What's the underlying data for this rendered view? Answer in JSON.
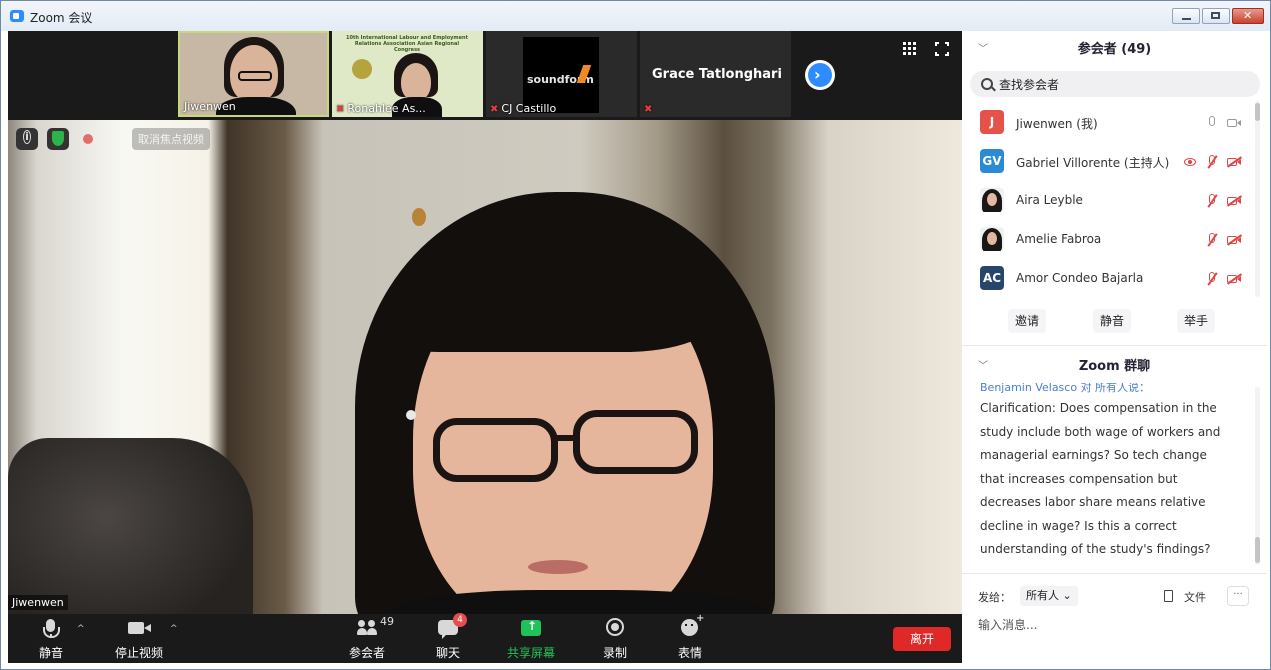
{
  "window": {
    "title": "Zoom 会议"
  },
  "thumbnails": [
    {
      "name": "Jiwenwen"
    },
    {
      "name": "Ronahlee As...",
      "poster_text": "10th International Labour and Employment Relations Association Asian Regional Congress"
    },
    {
      "name": "CJ Castillo",
      "logo_text": "soundform"
    },
    {
      "name": "Grace Tatlonghari"
    }
  ],
  "main_video": {
    "unpin_label": "取消焦点视频",
    "name_tag": "Jiwenwen"
  },
  "toolbar": {
    "mute": "静音",
    "stop_video": "停止视频",
    "participants": "参会者",
    "participants_count": "49",
    "chat": "聊天",
    "chat_badge": "4",
    "share": "共享屏幕",
    "record": "录制",
    "reactions": "表情",
    "leave": "离开"
  },
  "participants_panel": {
    "title": "参会者 (49)",
    "search_placeholder": "查找参会者",
    "items": [
      {
        "initials": "J",
        "name": "Jiwenwen (我)",
        "color": "#e5524a"
      },
      {
        "initials": "GV",
        "name": "Gabriel Villorente (主持人)",
        "color": "#2a8ad6"
      },
      {
        "initials": "",
        "name": "Aira Leyble",
        "color": "#f1f1f1"
      },
      {
        "initials": "",
        "name": "Amelie Fabroa",
        "color": "#f1f1f1"
      },
      {
        "initials": "AC",
        "name": "Amor Condeo Bajarla",
        "color": "#27466b"
      }
    ],
    "buttons": {
      "invite": "邀请",
      "mute_all": "静音",
      "raise_hand": "举手"
    }
  },
  "chat_panel": {
    "title": "Zoom 群聊",
    "sender": "Benjamin Velasco 对 所有人说：",
    "message": "Clarification: Does compensation in the study include both wage of workers and managerial earnings? So tech change that increases compensation but decreases labor share means relative decline in wage? Is this a correct understanding of the study's findings?",
    "send_to_label": "发给：",
    "send_to_value": "所有人",
    "file_label": "文件",
    "input_placeholder": "输入消息..."
  },
  "colors": {
    "accent": "#2d8cff",
    "leave": "#e02828",
    "share": "#20c35a"
  }
}
